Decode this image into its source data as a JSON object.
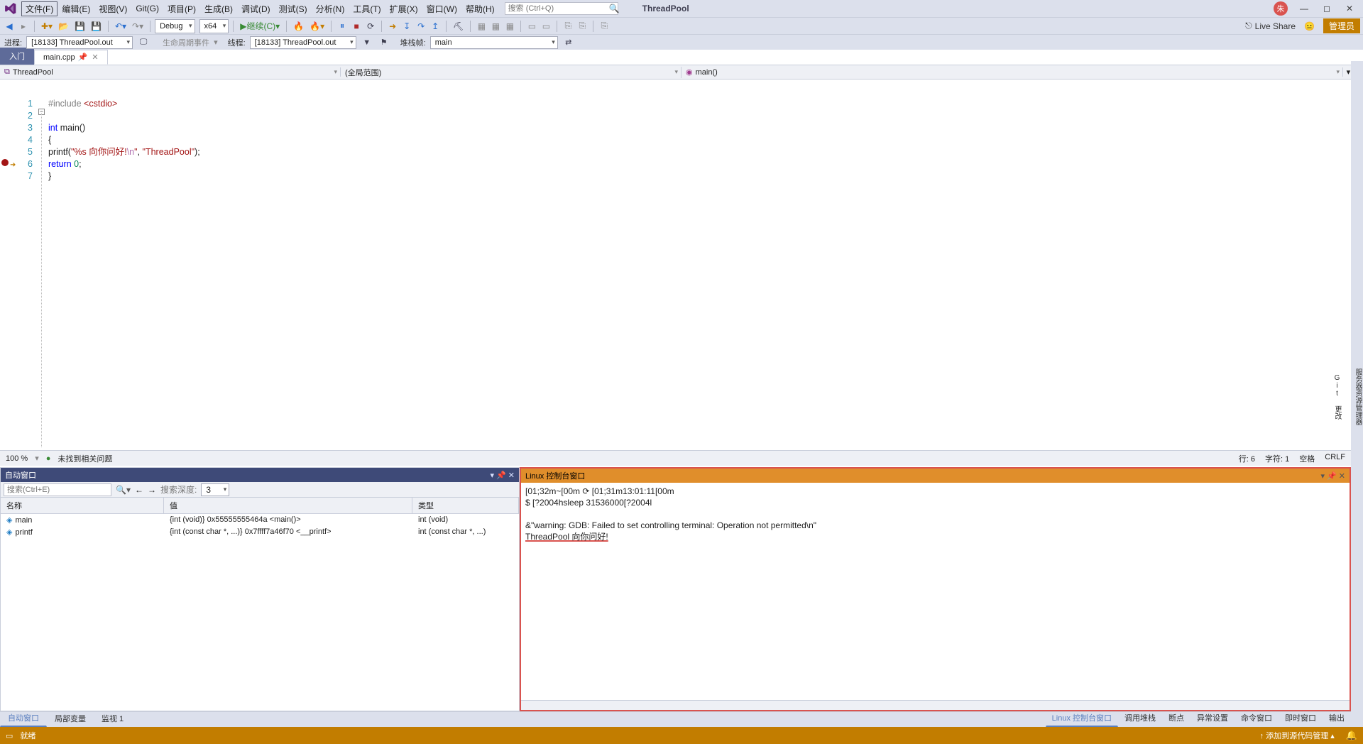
{
  "menu": {
    "file": "文件(F)",
    "edit": "编辑(E)",
    "view": "视图(V)",
    "git": "Git(G)",
    "project": "项目(P)",
    "build": "生成(B)",
    "debug": "调试(D)",
    "test": "测试(S)",
    "analyze": "分析(N)",
    "tools": "工具(T)",
    "extensions": "扩展(X)",
    "window": "窗口(W)",
    "help": "帮助(H)"
  },
  "search_placeholder": "搜索 (Ctrl+Q)",
  "app_title": "ThreadPool",
  "user_initial": "朱",
  "toolbar": {
    "config": "Debug",
    "platform": "x64",
    "continue": "继续(C)",
    "liveshare": "Live Share",
    "admin": "管理员"
  },
  "procbar": {
    "proc_lbl": "进程:",
    "proc_val": "[18133] ThreadPool.out",
    "lifecycle": "生命周期事件",
    "thread_lbl": "线程:",
    "thread_val": "[18133] ThreadPool.out",
    "stack_lbl": "堆栈帧:",
    "stack_val": "main"
  },
  "tabs": {
    "start": "入门",
    "active": "main.cpp"
  },
  "nav": {
    "scope": "ThreadPool",
    "combo2": "(全局范围)",
    "combo3": "main()"
  },
  "code": {
    "l1a": "#include ",
    "l1b": "<cstdio>",
    "l3a": "int ",
    "l3b": "main()",
    "l4": "{",
    "l5a": "    printf(",
    "l5b": "\"%s 向你问好!",
    "l5c": "\\n",
    "l5d": "\"",
    "l5e": ", ",
    "l5f": "\"ThreadPool\"",
    "l5g": ");",
    "l6a": "    ",
    "l6b": "return ",
    "l6c": "0",
    "l6d": ";",
    "l7": "}"
  },
  "zoom": "100 %",
  "issues": "未找到相关问题",
  "cursor": {
    "line": "行: 6",
    "col": "字符: 1",
    "ws": "空格",
    "eol": "CRLF"
  },
  "autos": {
    "title": "自动窗口",
    "search_ph": "搜索(Ctrl+E)",
    "depth_lbl": "搜索深度:",
    "depth_val": "3",
    "cols": {
      "name": "名称",
      "value": "值",
      "type": "类型"
    },
    "rows": [
      {
        "n": "main",
        "v": "{int (void)} 0x55555555464a <main()>",
        "t": "int (void)"
      },
      {
        "n": "printf",
        "v": "{int (const char *, ...)} 0x7ffff7a46f70 <__printf>",
        "t": "int (const char *, ...)"
      }
    ]
  },
  "console": {
    "title": "Linux 控制台窗口",
    "l1": "[01;32m~[00m ⟳ [01;31m13:01:11[00m",
    "l2": "$ [?2004hsleep 31536000[?2004l",
    "l3": "",
    "l4": "&\"warning: GDB: Failed to set controlling terminal: Operation not permitted\\n\"",
    "l5": "ThreadPool 向你问好!"
  },
  "tooltabs": {
    "left": [
      "自动窗口",
      "局部变量",
      "监视 1"
    ],
    "right": [
      "Linux 控制台窗口",
      "调用堆栈",
      "断点",
      "异常设置",
      "命令窗口",
      "即时窗口",
      "输出"
    ]
  },
  "status": {
    "ready": "就绪",
    "src": "添加到源代码管理"
  }
}
